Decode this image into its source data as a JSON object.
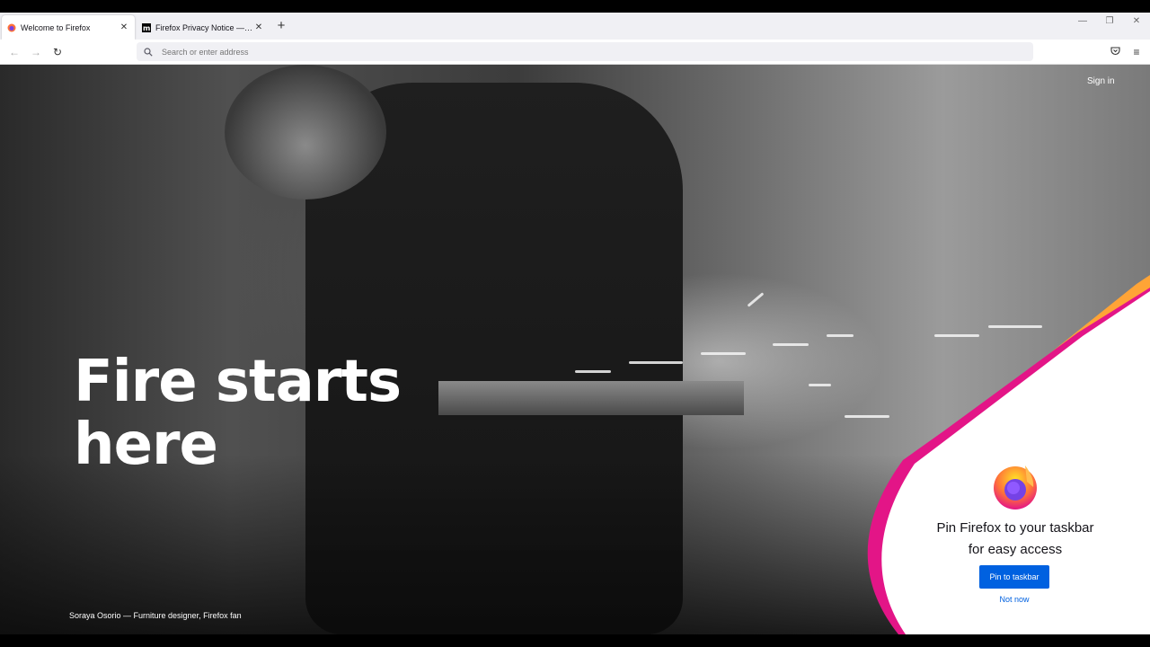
{
  "browser": {
    "tabs": [
      {
        "title": "Welcome to Firefox",
        "active": true
      },
      {
        "title": "Firefox Privacy Notice — Mozilla",
        "active": false
      }
    ],
    "new_tab_label": "+",
    "address_placeholder": "Search or enter address"
  },
  "page": {
    "sign_in": "Sign in",
    "headline_line1": "Fire starts",
    "headline_line2": "here",
    "photo_caption": "Soraya Osorio — Furniture designer, Firefox fan"
  },
  "pin_card": {
    "title_line1": "Pin Firefox to your taskbar",
    "title_line2": "for easy access",
    "primary_button": "Pin to taskbar",
    "secondary_link": "Not now"
  },
  "colors": {
    "accent_blue": "#0061e0",
    "orange": "#ffa436",
    "pink": "#e31587"
  }
}
